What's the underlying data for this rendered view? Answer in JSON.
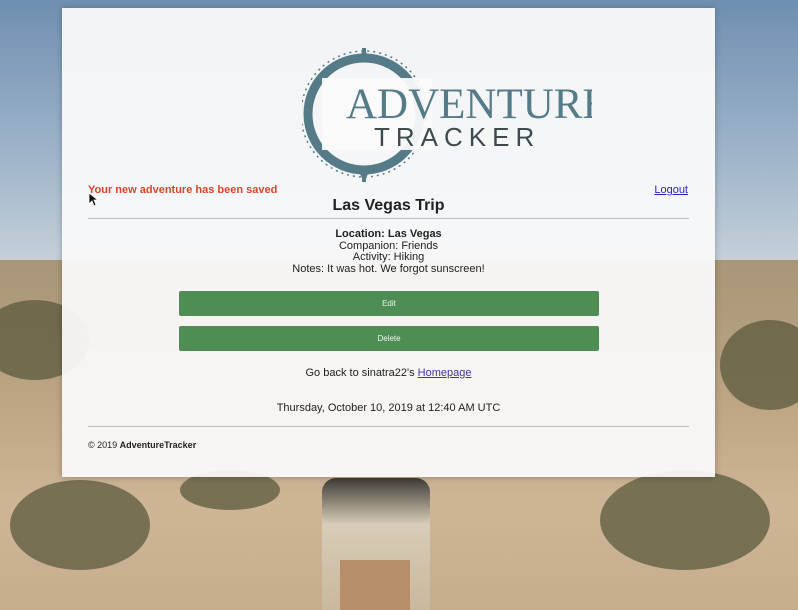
{
  "brand": {
    "logo_line1": "ADVENTURE",
    "logo_line2": "TRACKER",
    "logo_color": "#547b87"
  },
  "flash_message": "Your new adventure has been saved",
  "nav": {
    "logout_label": "Logout"
  },
  "trip": {
    "title": "Las Vegas Trip",
    "location": "Location: Las Vegas",
    "companion": "Companion: Friends",
    "activity": "Activity: Hiking",
    "notes": "Notes: It was hot. We forgot sunscreen!"
  },
  "actions": {
    "edit_label": "Edit",
    "delete_label": "Delete",
    "button_color": "#4e8e55"
  },
  "back_link": {
    "prefix": "Go back to sinatra22's ",
    "link_label": "Homepage"
  },
  "timestamp": "Thursday, October 10, 2019 at 12:40 AM UTC",
  "footer": {
    "copyright": "© 2019 ",
    "brand": "AdventureTracker"
  },
  "colors": {
    "flash": "#d9452b",
    "link": "#2a1fbf"
  }
}
